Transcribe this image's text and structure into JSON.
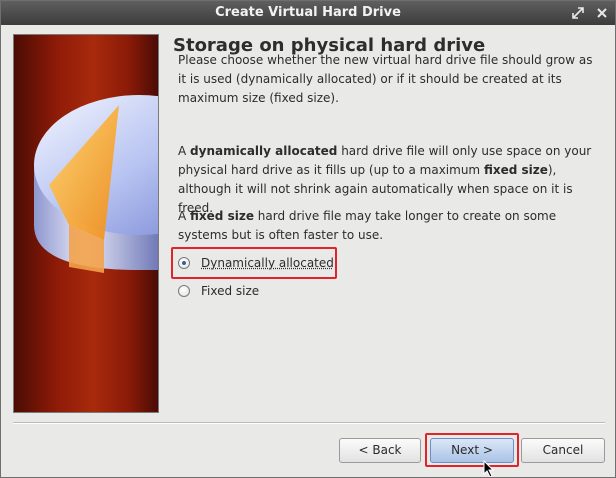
{
  "window": {
    "title": "Create Virtual Hard Drive"
  },
  "page": {
    "title": "Storage on physical hard drive",
    "para1": "Please choose whether the new virtual hard drive file should grow as it is used (dynamically allocated) or if it should be created at its maximum size (fixed size).",
    "para2": {
      "a": "A ",
      "b": "dynamically allocated",
      "c": " hard drive file will only use space on your physical hard drive as it fills up (up to a maximum ",
      "d": "fixed size",
      "e": "), although it will not shrink again automatically when space on it is freed."
    },
    "para3": {
      "a": "A ",
      "b": "fixed size",
      "c": " hard drive file may take longer to create on some systems but is often faster to use."
    }
  },
  "options": {
    "dynamic_label": "Dynamically allocated",
    "fixed_label": "Fixed size",
    "selected": "Dynamically allocated"
  },
  "buttons": {
    "back": "< Back",
    "next": "Next >",
    "cancel": "Cancel"
  },
  "colors": {
    "highlight": "#e0242a",
    "titlebar": "#4a4a4a",
    "accent": "#3b5f93"
  }
}
